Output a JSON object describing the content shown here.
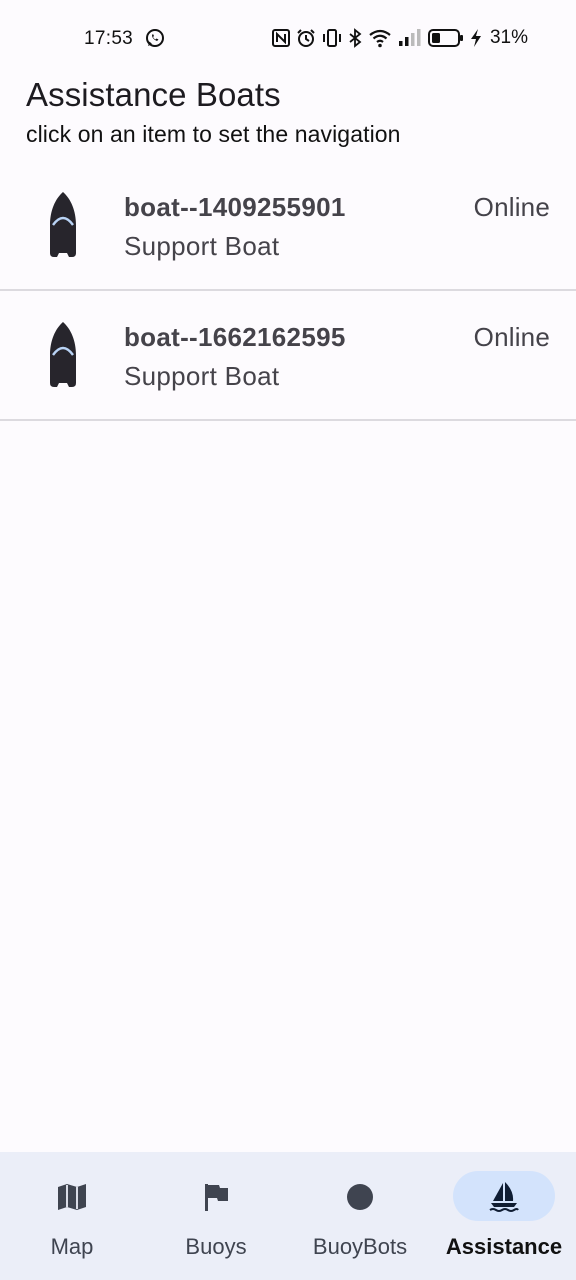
{
  "status_bar": {
    "time": "17:53",
    "battery_percent": "31%",
    "icons": [
      "whatsapp-icon",
      "nfc-icon",
      "alarm-icon",
      "vibrate-icon",
      "bluetooth-icon",
      "wifi-icon",
      "signal-icon",
      "battery-icon",
      "charging-icon"
    ]
  },
  "header": {
    "title": "Assistance Boats",
    "subtitle": "click on an item to set the navigation"
  },
  "boats": [
    {
      "name": "boat--1409255901",
      "type": "Support Boat",
      "status": "Online",
      "icon": "boat-icon"
    },
    {
      "name": "boat--1662162595",
      "type": "Support Boat",
      "status": "Online",
      "icon": "boat-icon"
    }
  ],
  "bottom_nav": {
    "items": [
      {
        "label": "Map",
        "icon": "map-icon",
        "active": false
      },
      {
        "label": "Buoys",
        "icon": "flag-icon",
        "active": false
      },
      {
        "label": "BuoyBots",
        "icon": "circle-icon",
        "active": false
      },
      {
        "label": "Assistance",
        "icon": "sailboat-icon",
        "active": true
      }
    ]
  },
  "colors": {
    "background": "#fdfbfe",
    "nav_background": "#ebeef8",
    "active_pill": "#d3e3fc",
    "text_secondary": "#45434a",
    "divider": "#dcdadf"
  }
}
